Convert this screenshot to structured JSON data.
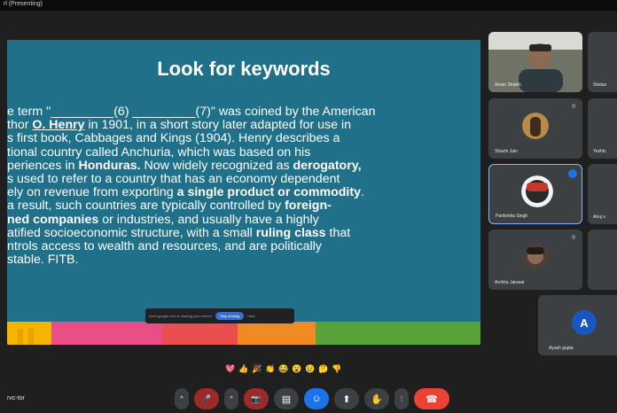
{
  "window": {
    "title": "rl (Presenting)"
  },
  "slide": {
    "title": "Look for keywords",
    "lines": [
      {
        "parts": [
          "e term \"",
          "_________(6) _________(7)\" was coined by the American"
        ]
      },
      {
        "parts": [
          "thor ",
          "O. Henry",
          " in 1901, in a short story later adapted for use in"
        ]
      },
      {
        "parts": [
          "s first book, Cabbages and Kings (1904). Henry describes a"
        ]
      },
      {
        "parts": [
          "tional country called Anchuria, which was based on his"
        ]
      },
      {
        "parts": [
          "periences in ",
          "Honduras.",
          " Now widely recognized as ",
          "derogatory,"
        ]
      },
      {
        "parts": [
          "s used to refer to a country that has an economy dependent"
        ]
      },
      {
        "parts": [
          "ely on revenue from exporting ",
          "a single product or commodity",
          "."
        ]
      },
      {
        "parts": [
          "a result, such countries are typically controlled by ",
          "foreign-"
        ]
      },
      {
        "parts": [
          "ned companies",
          " or industries, and usually have a highly"
        ]
      },
      {
        "parts": [
          "atified socioeconomic structure, with a small ",
          "ruling class",
          " that"
        ]
      },
      {
        "parts": [
          "ntrols access to wealth and resources, and are politically"
        ]
      },
      {
        "parts": [
          "stable. FITB."
        ]
      }
    ],
    "share_bar": {
      "text": "meet.google.com is sharing your screen",
      "stop_label": "Stop sharing",
      "hide_label": "Hide"
    }
  },
  "participants": [
    {
      "name": "Aman Shaikh",
      "muted": false
    },
    {
      "name": "Shelav",
      "muted": false
    },
    {
      "name": "Shachi Jain",
      "muted": true
    },
    {
      "name": "Yeshtc",
      "muted": false
    },
    {
      "name": "Parikshita Singh",
      "muted": false
    },
    {
      "name": "Anuj s",
      "muted": false
    },
    {
      "name": "Archita Jaiswal",
      "muted": true
    },
    {
      "name": "Ayush gupta",
      "initial": "A",
      "muted": false
    }
  ],
  "reactions": [
    "💖",
    "👍",
    "🎉",
    "👏",
    "😂",
    "😮",
    "😢",
    "🤔",
    "👎"
  ],
  "controls": {
    "meeting_code": "rvc-tor",
    "mic_icon": "🎤",
    "camera_icon": "📷",
    "captions_icon": "▤",
    "reactions_icon": "☺",
    "present_icon": "⬆",
    "hand_icon": "✋",
    "more_icon": "⋮",
    "end_icon": "☎",
    "chevron": "^"
  },
  "colors": {
    "slide_bg": "#1f7088",
    "tile_bg": "#3c4043",
    "highlight_border": "#8ab4f8",
    "end_call": "#ea4335"
  }
}
